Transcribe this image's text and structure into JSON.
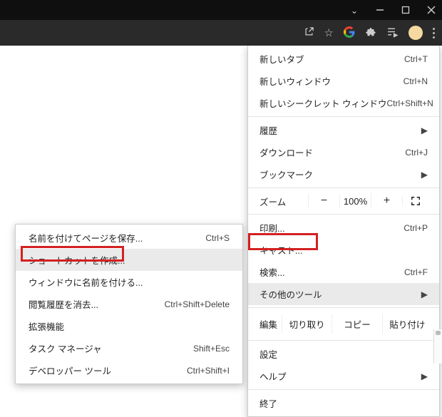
{
  "window": {
    "chevron": "⌄"
  },
  "menu": {
    "newTab": {
      "label": "新しいタブ",
      "accel": "Ctrl+T"
    },
    "newWindow": {
      "label": "新しいウィンドウ",
      "accel": "Ctrl+N"
    },
    "newIncognito": {
      "label": "新しいシークレット ウィンドウ",
      "accel": "Ctrl+Shift+N"
    },
    "history": {
      "label": "履歴"
    },
    "downloads": {
      "label": "ダウンロード",
      "accel": "Ctrl+J"
    },
    "bookmarks": {
      "label": "ブックマーク"
    },
    "zoom": {
      "label": "ズーム",
      "minus": "−",
      "value": "100%",
      "plus": "+"
    },
    "print": {
      "label": "印刷...",
      "accel": "Ctrl+P"
    },
    "cast": {
      "label": "キャスト..."
    },
    "find": {
      "label": "検索...",
      "accel": "Ctrl+F"
    },
    "moreTools": {
      "label": "その他のツール"
    },
    "edit": {
      "label": "編集",
      "cut": "切り取り",
      "copy": "コピー",
      "paste": "貼り付け"
    },
    "settings": {
      "label": "設定"
    },
    "help": {
      "label": "ヘルプ"
    },
    "exit": {
      "label": "終了"
    }
  },
  "submenu": {
    "savePage": {
      "label": "名前を付けてページを保存...",
      "accel": "Ctrl+S"
    },
    "createShortcut": {
      "label": "ショートカットを作成..."
    },
    "nameWindow": {
      "label": "ウィンドウに名前を付ける..."
    },
    "clearBrowsing": {
      "label": "閲覧履歴を消去...",
      "accel": "Ctrl+Shift+Delete"
    },
    "extensions": {
      "label": "拡張機能"
    },
    "taskManager": {
      "label": "タスク マネージャ",
      "accel": "Shift+Esc"
    },
    "devTools": {
      "label": "デベロッパー ツール",
      "accel": "Ctrl+Shift+I"
    }
  }
}
